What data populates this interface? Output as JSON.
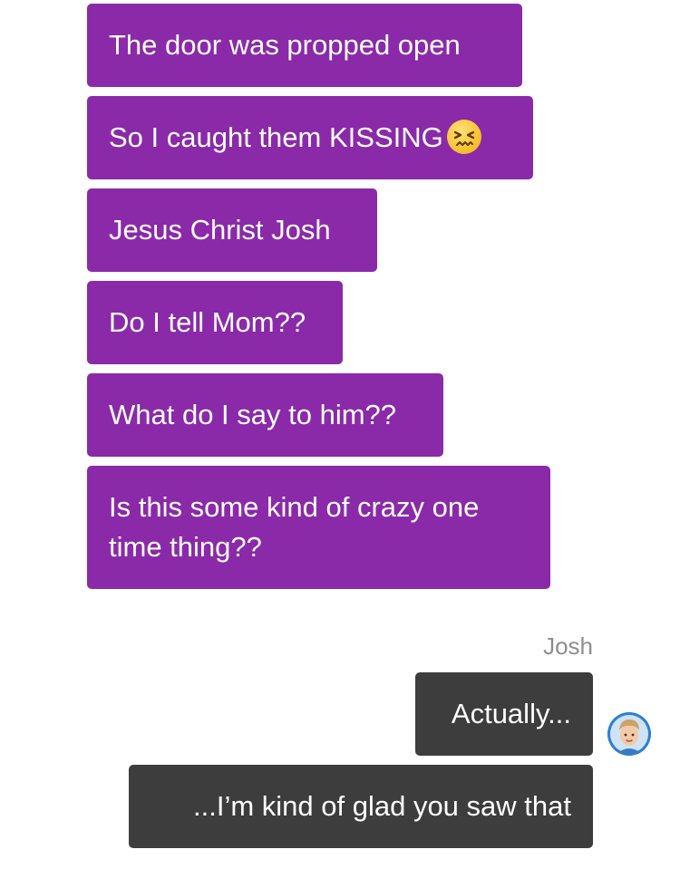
{
  "chat": {
    "incoming": [
      {
        "text": "The door was propped open"
      },
      {
        "text": "So I caught them KISSING",
        "emoji": "confounded-face-icon"
      },
      {
        "text": "Jesus Christ Josh"
      },
      {
        "text": "Do I tell Mom??"
      },
      {
        "text": "What do I say to him??"
      },
      {
        "text": "Is this some kind of crazy one time thing??"
      }
    ],
    "outgoing_sender": "Josh",
    "outgoing": [
      {
        "text": "Actually..."
      },
      {
        "text": "...I’m kind of glad you saw that"
      }
    ]
  },
  "colors": {
    "incoming_bubble": "#8a2aa8",
    "outgoing_bubble": "#3d3d3d",
    "sender_label": "#8e8e8e",
    "background": "#ffffff"
  }
}
